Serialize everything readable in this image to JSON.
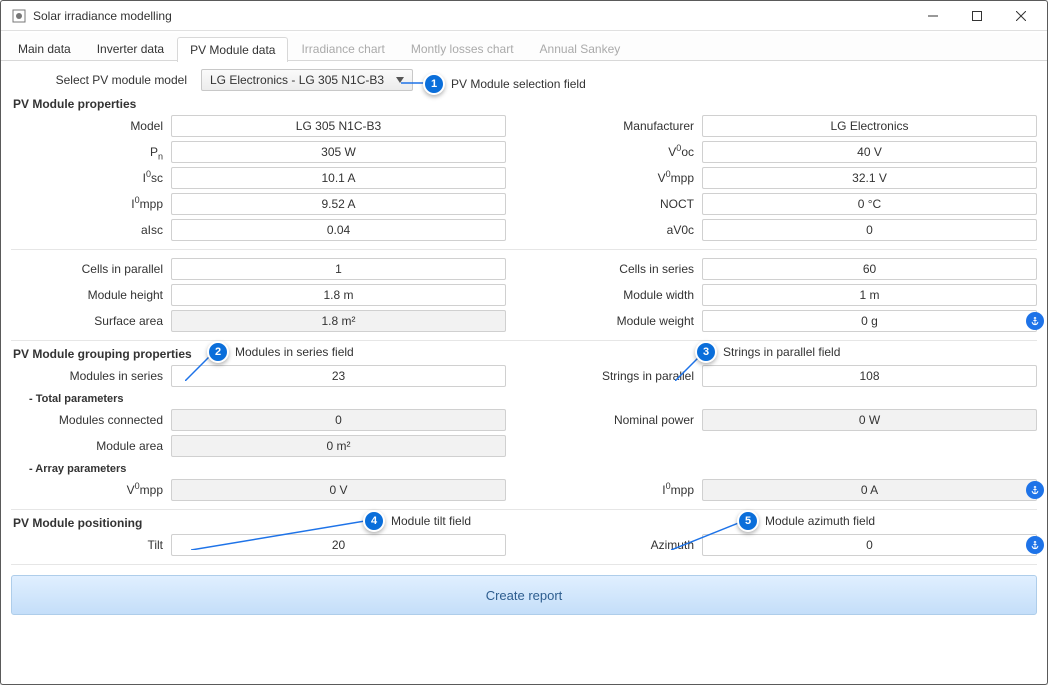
{
  "window": {
    "title": "Solar irradiance modelling"
  },
  "tabs": [
    {
      "label": "Main data",
      "state": "normal"
    },
    {
      "label": "Inverter data",
      "state": "normal"
    },
    {
      "label": "PV Module data",
      "state": "selected"
    },
    {
      "label": "Irradiance chart",
      "state": "inactive"
    },
    {
      "label": "Montly losses chart",
      "state": "inactive"
    },
    {
      "label": "Annual Sankey",
      "state": "inactive"
    }
  ],
  "selector": {
    "label": "Select PV module model",
    "value": "LG Electronics - LG 305 N1C-B3"
  },
  "callouts": {
    "1": "PV Module selection field",
    "2": "Modules in series field",
    "3": "Strings in parallel field",
    "4": "Module tilt field",
    "5": "Module azimuth field"
  },
  "sections": {
    "properties_title": "PV Module properties",
    "grouping_title": "PV Module grouping properties",
    "total_title": "- Total parameters",
    "array_title": "- Array parameters",
    "positioning_title": "PV Module positioning"
  },
  "fields": {
    "model": {
      "label": "Model",
      "value": "LG 305 N1C-B3"
    },
    "manufacturer": {
      "label": "Manufacturer",
      "value": "LG Electronics"
    },
    "pn": {
      "label_html": "P<sub>n</sub>",
      "value": "305 W"
    },
    "voc": {
      "label_html": "V<sup>0</sup>oc",
      "value": "40 V"
    },
    "isc": {
      "label_html": "I<sup>0</sup>sc",
      "value": "10.1 A"
    },
    "vmpp": {
      "label_html": "V<sup>0</sup>mpp",
      "value": "32.1 V"
    },
    "impp": {
      "label_html": "I<sup>0</sup>mpp",
      "value": "9.52 A"
    },
    "noct": {
      "label": "NOCT",
      "value": "0 °C"
    },
    "aisc": {
      "label": "aIsc",
      "value": "0.04"
    },
    "av0c": {
      "label": "aV0c",
      "value": "0"
    },
    "cells_parallel": {
      "label": "Cells in parallel",
      "value": "1"
    },
    "cells_series": {
      "label": "Cells in series",
      "value": "60"
    },
    "module_height": {
      "label": "Module height",
      "value": "1.8 m"
    },
    "module_width": {
      "label": "Module width",
      "value": "1 m"
    },
    "surface_area": {
      "label": "Surface area",
      "value": "1.8 m²"
    },
    "module_weight": {
      "label": "Module weight",
      "value": "0 g"
    },
    "modules_series": {
      "label": "Modules in series",
      "value": "23"
    },
    "strings_parallel": {
      "label": "Strings in parallel",
      "value": "108"
    },
    "modules_connected": {
      "label": "Modules connected",
      "value": "0"
    },
    "nominal_power": {
      "label": "Nominal power",
      "value": "0 W"
    },
    "module_area": {
      "label": "Module area",
      "value": "0 m²"
    },
    "arr_vmpp": {
      "label_html": "V<sup>0</sup>mpp",
      "value": "0 V"
    },
    "arr_impp": {
      "label_html": "I<sup>0</sup>mpp",
      "value": "0 A"
    },
    "tilt": {
      "label": "Tilt",
      "value": "20"
    },
    "azimuth": {
      "label": "Azimuth",
      "value": "0"
    }
  },
  "buttons": {
    "create_report": "Create report"
  }
}
